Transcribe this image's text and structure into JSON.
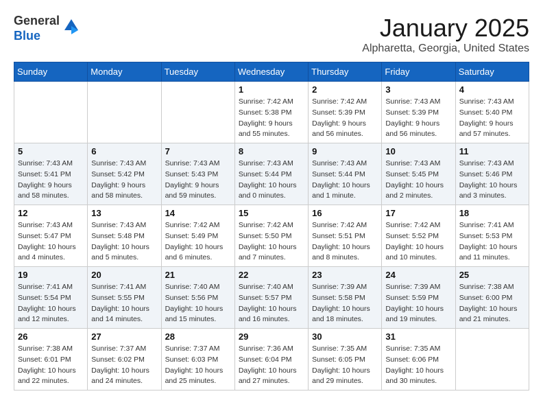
{
  "header": {
    "logo_general": "General",
    "logo_blue": "Blue",
    "month_title": "January 2025",
    "location": "Alpharetta, Georgia, United States"
  },
  "weekdays": [
    "Sunday",
    "Monday",
    "Tuesday",
    "Wednesday",
    "Thursday",
    "Friday",
    "Saturday"
  ],
  "weeks": [
    [
      {
        "day": "",
        "sunrise": "",
        "sunset": "",
        "daylight": ""
      },
      {
        "day": "",
        "sunrise": "",
        "sunset": "",
        "daylight": ""
      },
      {
        "day": "",
        "sunrise": "",
        "sunset": "",
        "daylight": ""
      },
      {
        "day": "1",
        "sunrise": "Sunrise: 7:42 AM",
        "sunset": "Sunset: 5:38 PM",
        "daylight": "Daylight: 9 hours and 55 minutes."
      },
      {
        "day": "2",
        "sunrise": "Sunrise: 7:42 AM",
        "sunset": "Sunset: 5:39 PM",
        "daylight": "Daylight: 9 hours and 56 minutes."
      },
      {
        "day": "3",
        "sunrise": "Sunrise: 7:43 AM",
        "sunset": "Sunset: 5:39 PM",
        "daylight": "Daylight: 9 hours and 56 minutes."
      },
      {
        "day": "4",
        "sunrise": "Sunrise: 7:43 AM",
        "sunset": "Sunset: 5:40 PM",
        "daylight": "Daylight: 9 hours and 57 minutes."
      }
    ],
    [
      {
        "day": "5",
        "sunrise": "Sunrise: 7:43 AM",
        "sunset": "Sunset: 5:41 PM",
        "daylight": "Daylight: 9 hours and 58 minutes."
      },
      {
        "day": "6",
        "sunrise": "Sunrise: 7:43 AM",
        "sunset": "Sunset: 5:42 PM",
        "daylight": "Daylight: 9 hours and 58 minutes."
      },
      {
        "day": "7",
        "sunrise": "Sunrise: 7:43 AM",
        "sunset": "Sunset: 5:43 PM",
        "daylight": "Daylight: 9 hours and 59 minutes."
      },
      {
        "day": "8",
        "sunrise": "Sunrise: 7:43 AM",
        "sunset": "Sunset: 5:44 PM",
        "daylight": "Daylight: 10 hours and 0 minutes."
      },
      {
        "day": "9",
        "sunrise": "Sunrise: 7:43 AM",
        "sunset": "Sunset: 5:44 PM",
        "daylight": "Daylight: 10 hours and 1 minute."
      },
      {
        "day": "10",
        "sunrise": "Sunrise: 7:43 AM",
        "sunset": "Sunset: 5:45 PM",
        "daylight": "Daylight: 10 hours and 2 minutes."
      },
      {
        "day": "11",
        "sunrise": "Sunrise: 7:43 AM",
        "sunset": "Sunset: 5:46 PM",
        "daylight": "Daylight: 10 hours and 3 minutes."
      }
    ],
    [
      {
        "day": "12",
        "sunrise": "Sunrise: 7:43 AM",
        "sunset": "Sunset: 5:47 PM",
        "daylight": "Daylight: 10 hours and 4 minutes."
      },
      {
        "day": "13",
        "sunrise": "Sunrise: 7:43 AM",
        "sunset": "Sunset: 5:48 PM",
        "daylight": "Daylight: 10 hours and 5 minutes."
      },
      {
        "day": "14",
        "sunrise": "Sunrise: 7:42 AM",
        "sunset": "Sunset: 5:49 PM",
        "daylight": "Daylight: 10 hours and 6 minutes."
      },
      {
        "day": "15",
        "sunrise": "Sunrise: 7:42 AM",
        "sunset": "Sunset: 5:50 PM",
        "daylight": "Daylight: 10 hours and 7 minutes."
      },
      {
        "day": "16",
        "sunrise": "Sunrise: 7:42 AM",
        "sunset": "Sunset: 5:51 PM",
        "daylight": "Daylight: 10 hours and 8 minutes."
      },
      {
        "day": "17",
        "sunrise": "Sunrise: 7:42 AM",
        "sunset": "Sunset: 5:52 PM",
        "daylight": "Daylight: 10 hours and 10 minutes."
      },
      {
        "day": "18",
        "sunrise": "Sunrise: 7:41 AM",
        "sunset": "Sunset: 5:53 PM",
        "daylight": "Daylight: 10 hours and 11 minutes."
      }
    ],
    [
      {
        "day": "19",
        "sunrise": "Sunrise: 7:41 AM",
        "sunset": "Sunset: 5:54 PM",
        "daylight": "Daylight: 10 hours and 12 minutes."
      },
      {
        "day": "20",
        "sunrise": "Sunrise: 7:41 AM",
        "sunset": "Sunset: 5:55 PM",
        "daylight": "Daylight: 10 hours and 14 minutes."
      },
      {
        "day": "21",
        "sunrise": "Sunrise: 7:40 AM",
        "sunset": "Sunset: 5:56 PM",
        "daylight": "Daylight: 10 hours and 15 minutes."
      },
      {
        "day": "22",
        "sunrise": "Sunrise: 7:40 AM",
        "sunset": "Sunset: 5:57 PM",
        "daylight": "Daylight: 10 hours and 16 minutes."
      },
      {
        "day": "23",
        "sunrise": "Sunrise: 7:39 AM",
        "sunset": "Sunset: 5:58 PM",
        "daylight": "Daylight: 10 hours and 18 minutes."
      },
      {
        "day": "24",
        "sunrise": "Sunrise: 7:39 AM",
        "sunset": "Sunset: 5:59 PM",
        "daylight": "Daylight: 10 hours and 19 minutes."
      },
      {
        "day": "25",
        "sunrise": "Sunrise: 7:38 AM",
        "sunset": "Sunset: 6:00 PM",
        "daylight": "Daylight: 10 hours and 21 minutes."
      }
    ],
    [
      {
        "day": "26",
        "sunrise": "Sunrise: 7:38 AM",
        "sunset": "Sunset: 6:01 PM",
        "daylight": "Daylight: 10 hours and 22 minutes."
      },
      {
        "day": "27",
        "sunrise": "Sunrise: 7:37 AM",
        "sunset": "Sunset: 6:02 PM",
        "daylight": "Daylight: 10 hours and 24 minutes."
      },
      {
        "day": "28",
        "sunrise": "Sunrise: 7:37 AM",
        "sunset": "Sunset: 6:03 PM",
        "daylight": "Daylight: 10 hours and 25 minutes."
      },
      {
        "day": "29",
        "sunrise": "Sunrise: 7:36 AM",
        "sunset": "Sunset: 6:04 PM",
        "daylight": "Daylight: 10 hours and 27 minutes."
      },
      {
        "day": "30",
        "sunrise": "Sunrise: 7:35 AM",
        "sunset": "Sunset: 6:05 PM",
        "daylight": "Daylight: 10 hours and 29 minutes."
      },
      {
        "day": "31",
        "sunrise": "Sunrise: 7:35 AM",
        "sunset": "Sunset: 6:06 PM",
        "daylight": "Daylight: 10 hours and 30 minutes."
      },
      {
        "day": "",
        "sunrise": "",
        "sunset": "",
        "daylight": ""
      }
    ]
  ]
}
